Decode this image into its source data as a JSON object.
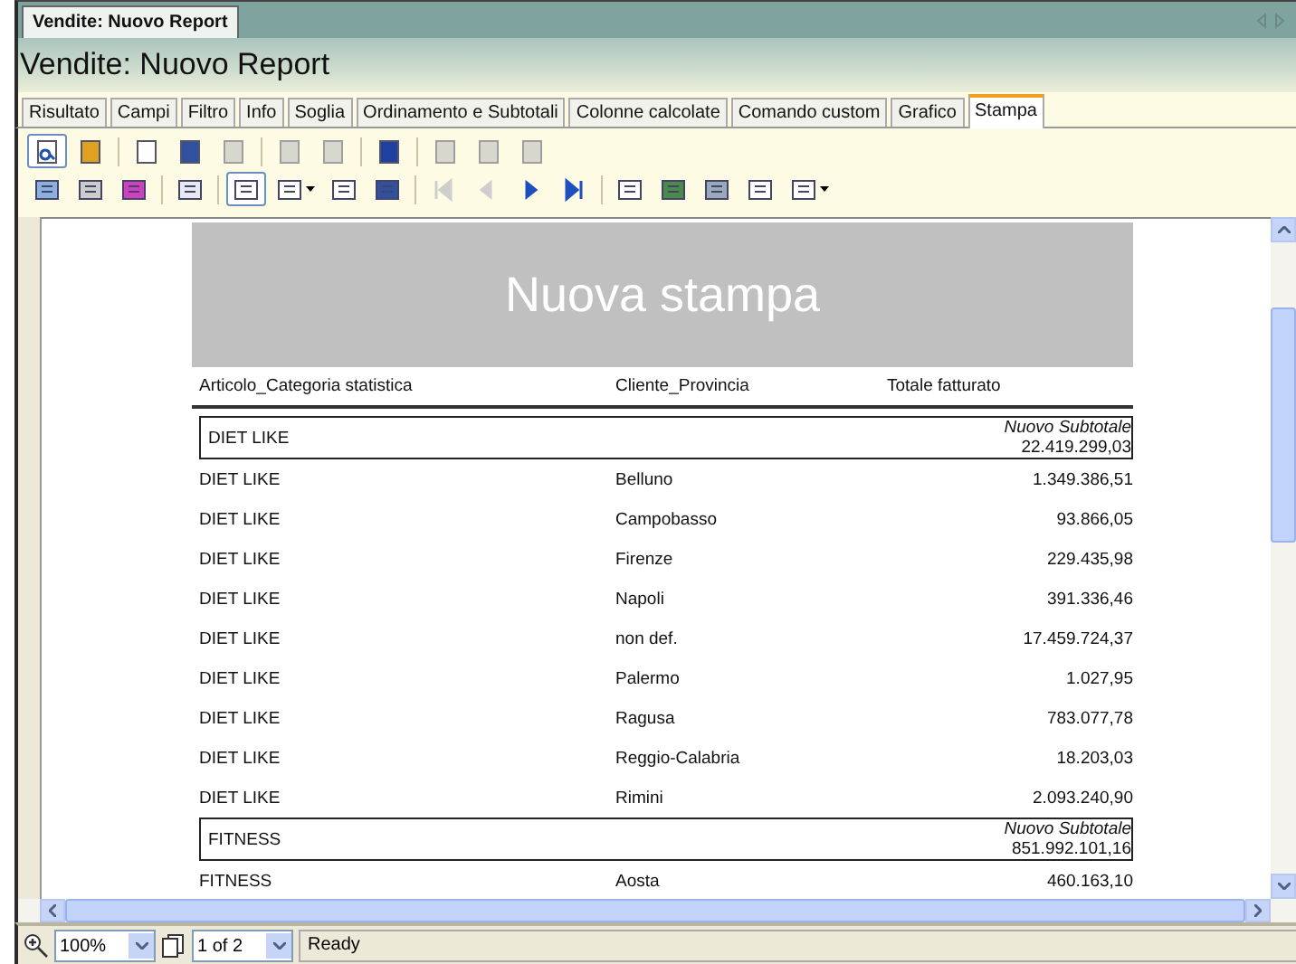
{
  "document_tab": {
    "label": "Vendite: Nuovo Report",
    "selected": true
  },
  "title": "Vendite: Nuovo Report",
  "tabs": [
    {
      "label": "Risultato",
      "selected": false
    },
    {
      "label": "Campi",
      "selected": false
    },
    {
      "label": "Filtro",
      "selected": false
    },
    {
      "label": "Info",
      "selected": false
    },
    {
      "label": "Soglia",
      "selected": false
    },
    {
      "label": "Ordinamento e Subtotali",
      "selected": false
    },
    {
      "label": "Colonne calcolate",
      "selected": false
    },
    {
      "label": "Comando custom",
      "selected": false
    },
    {
      "label": "Grafico",
      "selected": false
    },
    {
      "label": "Stampa",
      "selected": true
    }
  ],
  "toolbar_1": [
    {
      "selected": true,
      "disabled": false
    },
    {
      "selected": false,
      "disabled": false
    },
    {
      "selected": false,
      "disabled": false
    },
    {
      "selected": false,
      "disabled": false
    },
    {
      "selected": false,
      "disabled": true
    },
    {
      "selected": false,
      "disabled": true
    },
    {
      "selected": false,
      "disabled": true
    },
    {
      "selected": false,
      "disabled": false
    },
    {
      "selected": false,
      "disabled": true
    },
    {
      "selected": false,
      "disabled": true
    },
    {
      "selected": false,
      "disabled": true
    }
  ],
  "toolbar_2": [
    {
      "selected": false,
      "disabled": false
    },
    {
      "selected": false,
      "disabled": false
    },
    {
      "selected": false,
      "disabled": false
    },
    {
      "selected": false,
      "disabled": false
    },
    {
      "selected": true,
      "disabled": false
    },
    {
      "selected": false,
      "disabled": false
    },
    {
      "selected": false,
      "disabled": false
    },
    {
      "selected": false,
      "disabled": false
    },
    {
      "selected": false,
      "disabled": true
    },
    {
      "selected": false,
      "disabled": true
    },
    {
      "selected": false,
      "disabled": false
    },
    {
      "selected": false,
      "disabled": false
    },
    {
      "selected": false,
      "disabled": false
    },
    {
      "selected": false,
      "disabled": false
    },
    {
      "selected": false,
      "disabled": false
    },
    {
      "selected": false,
      "disabled": false
    },
    {
      "selected": false,
      "disabled": false
    }
  ],
  "report": {
    "title": "Nuova stampa",
    "columns": [
      "Articolo_Categoria statistica",
      "Cliente_Provincia",
      "Totale fatturato"
    ],
    "rows": [
      {
        "kind": "group",
        "category": "DIET LIKE",
        "subtotal_label": "Nuovo Subtotale",
        "subtotal": "22.419.299,03"
      },
      {
        "kind": "detail",
        "category": "DIET LIKE",
        "province": "Belluno",
        "total": "1.349.386,51"
      },
      {
        "kind": "detail",
        "category": "DIET LIKE",
        "province": "Campobasso",
        "total": "93.866,05"
      },
      {
        "kind": "detail",
        "category": "DIET LIKE",
        "province": "Firenze",
        "total": "229.435,98"
      },
      {
        "kind": "detail",
        "category": "DIET LIKE",
        "province": "Napoli",
        "total": "391.336,46"
      },
      {
        "kind": "detail",
        "category": "DIET LIKE",
        "province": "non def.",
        "total": "17.459.724,37"
      },
      {
        "kind": "detail",
        "category": "DIET LIKE",
        "province": "Palermo",
        "total": "1.027,95"
      },
      {
        "kind": "detail",
        "category": "DIET LIKE",
        "province": "Ragusa",
        "total": "783.077,78"
      },
      {
        "kind": "detail",
        "category": "DIET LIKE",
        "province": "Reggio-Calabria",
        "total": "18.203,03"
      },
      {
        "kind": "detail",
        "category": "DIET LIKE",
        "province": "Rimini",
        "total": "2.093.240,90"
      },
      {
        "kind": "group",
        "category": "FITNESS",
        "subtotal_label": "Nuovo Subtotale",
        "subtotal": "851.992.101,16"
      },
      {
        "kind": "detail",
        "category": "FITNESS",
        "province": "Aosta",
        "total": "460.163,10"
      }
    ]
  },
  "status_bar": {
    "zoom": "100%",
    "page": "1 of 2",
    "status": "Ready"
  }
}
